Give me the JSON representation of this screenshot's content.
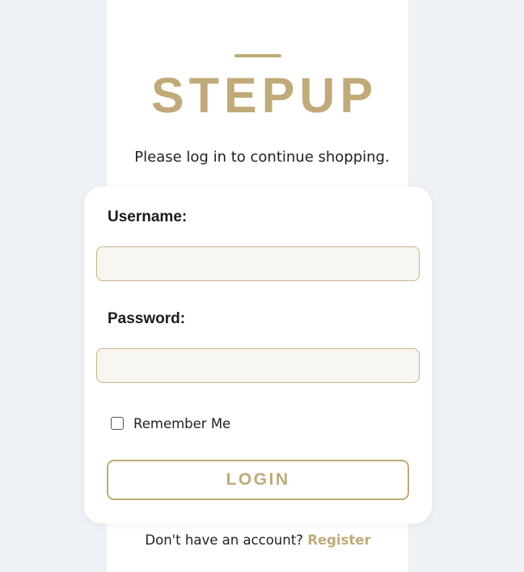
{
  "brand": {
    "name": "STEPUP",
    "accent_color": "#c0aa78"
  },
  "tagline": "Please log in to continue shopping.",
  "form": {
    "username_label": "Username:",
    "username_value": "",
    "password_label": "Password:",
    "password_value": "",
    "remember_label": "Remember Me",
    "remember_checked": false,
    "login_label": "LOGIN"
  },
  "footer": {
    "prompt": "Don't have an account?",
    "register_label": "Register"
  }
}
